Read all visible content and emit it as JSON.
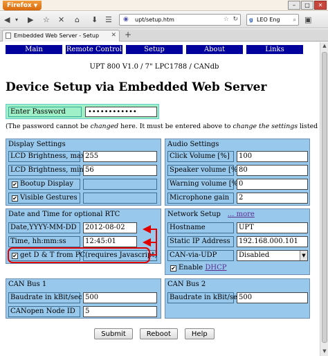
{
  "browser": {
    "app_button": "Firefox",
    "url": "upt/setup.htm",
    "search_text": "LEO Eng",
    "tab_title": "Embedded Web Server - Setup"
  },
  "menu": [
    "Main",
    "Remote Control",
    "Setup",
    "About",
    "Links"
  ],
  "page": {
    "subtitle": "UPT 800 V1.0 / 7\" LPC1788 / CANdb",
    "heading": "Device Setup via Embedded Web Server",
    "password_label": "Enter Password",
    "password_value": "••••••••••••",
    "note_a": "(The password cannot be ",
    "note_b": "changed",
    "note_c": " here. It must be entered above to ",
    "note_d": "change the settings",
    "note_e": " listed below.)"
  },
  "display": {
    "title": "Display Settings",
    "brightness_max_label": "LCD Brightness, max",
    "brightness_max": "255",
    "brightness_min_label": "LCD Brightness, min",
    "brightness_min": "56",
    "bootup_label": "Bootup Display",
    "gestures_label": "Visible Gestures"
  },
  "audio": {
    "title": "Audio Settings",
    "click_label": "Click Volume [%]",
    "click": "100",
    "speaker_label": "Speaker volume [%]",
    "speaker": "80",
    "warning_label": "Warning volume [%]",
    "warning": "0",
    "mic_label": "Microphone gain",
    "mic": "2"
  },
  "datetime": {
    "title": "Date and Time for optional RTC",
    "date_label": "Date,YYYY-MM-DD",
    "date": "2012-08-02",
    "time_label": "Time, hh:mm:ss",
    "time": "12:45:01",
    "getpc_label": "get D & T from PC",
    "getpc_note": "(requires Javascript)"
  },
  "network": {
    "title": "Network Setup",
    "more": "... more",
    "hostname_label": "Hostname",
    "hostname": "UPT",
    "ip_label": "Static IP Address",
    "ip": "192.168.000.101",
    "canudp_label": "CAN-via-UDP",
    "canudp": "Disabled",
    "dhcp_prefix": "Enable ",
    "dhcp": "DHCP"
  },
  "can1": {
    "title": "CAN Bus 1",
    "baud_label": "Baudrate in kBit/sec",
    "baud": "500",
    "node_label": "CANopen Node ID",
    "node": "5"
  },
  "can2": {
    "title": "CAN Bus 2",
    "baud_label": "Baudrate in kBit/sec",
    "baud": "500"
  },
  "buttons": {
    "submit": "Submit",
    "reboot": "Reboot",
    "help": "Help"
  },
  "checkmark": "✔",
  "colors": {
    "menu": "#00009c",
    "panel": "#98c8ec",
    "password_box": "#9ff0c6",
    "annotation": "#e00000"
  }
}
